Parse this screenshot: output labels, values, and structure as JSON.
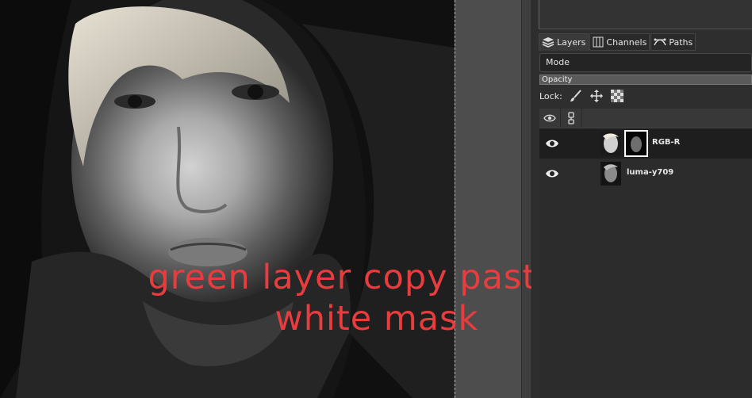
{
  "canvas": {
    "overlay_caption_line1": "green layer copy paste to",
    "overlay_caption_line2": "white mask"
  },
  "dock": {
    "tabs": [
      {
        "label": "Layers",
        "icon": "layers-icon"
      },
      {
        "label": "Channels",
        "icon": "channels-icon"
      },
      {
        "label": "Paths",
        "icon": "paths-icon"
      }
    ],
    "mode_label": "Mode",
    "opacity_label": "Opacity",
    "lock_label": "Lock:",
    "lock_icons": [
      "paint-brush-icon",
      "move-arrows-icon",
      "checkerboard-icon"
    ],
    "header_icons": [
      "visibility-eye-icon",
      "chain-link-icon"
    ],
    "layers": [
      {
        "name": "RGB-R",
        "selected": true,
        "has_mask": true
      },
      {
        "name": "luma-y709",
        "selected": false,
        "has_mask": false
      }
    ]
  },
  "colors": {
    "caption": "#e83c3e",
    "canvas_boundary": "#b5d63b",
    "panel_bg": "#2e2e2e"
  }
}
